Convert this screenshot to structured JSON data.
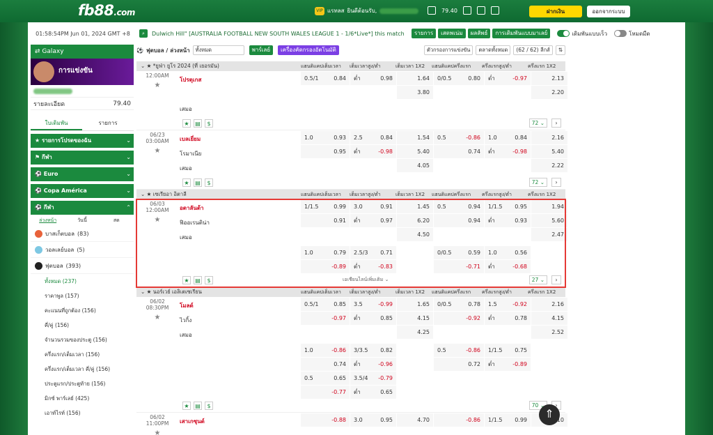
{
  "header": {
    "logo": "fb88",
    "logo_com": ".com",
    "user_label": "แรทลส",
    "greet": "ยินดีต้อนรับ,",
    "bal": "79.40",
    "vip": "VIP",
    "deposit": "ฝากเงิน",
    "logout": "ออกจากระบบ"
  },
  "strip": {
    "time": "01:58:54PM Jun 01, 2024 GMT +8",
    "marquee": "Dulwich Hill\" [AUSTRALIA FOOTBALL NEW SOUTH WALES LEAGUE 1 - 1/6*Live*] this match",
    "b1": "รายการ",
    "b2": "เสดพเน่ม",
    "b3": "ผลลัพธ์",
    "b4": "การเดิมพันแบบมาเลย์",
    "t1": "เดิมพันแบบเร็ว",
    "t2": "โหมดมืด"
  },
  "sidebar": {
    "galaxy": "Galaxy",
    "promo": "การแข่งขัน",
    "bal_label": "รายละเอียด",
    "bal_val": "79.40",
    "tab1": "ใบเดิมพัน",
    "tab2": "รายการ",
    "s1": "รายการโปรดของฉัน",
    "s2": "กีฬา",
    "s3": "Euro",
    "s4": "Copa América",
    "s5": "กีฬา",
    "sub1": "ล่วงหน้า",
    "sub2": "วันนี้",
    "sub3": "สด",
    "sports": [
      {
        "n": "บาสเก็ตบอล",
        "c": "(83)"
      },
      {
        "n": "วอลเลย์บอล",
        "c": "(5)"
      },
      {
        "n": "ฟุตบอล",
        "c": "(393)"
      }
    ],
    "markets": [
      {
        "n": "ทั้งหมด",
        "c": "(237)"
      },
      {
        "n": "ราคาพูล",
        "c": "(157)"
      },
      {
        "n": "คะแนนที่ถูกต้อง",
        "c": "(156)"
      },
      {
        "n": "คี่/คู่",
        "c": "(156)"
      },
      {
        "n": "จำนวนรวมของประตู",
        "c": "(156)"
      },
      {
        "n": "ครึ่งแรก/เต็มเวลา",
        "c": "(156)"
      },
      {
        "n": "ครึ่งแรก/เต็มเวลา คี่/คู่",
        "c": "(156)"
      },
      {
        "n": "ประตูแรก/ประตูท้าย",
        "c": "(156)"
      },
      {
        "n": "มิกซ์ พาร์เลย์",
        "c": "(425)"
      },
      {
        "n": "เอาท์ไรท์",
        "c": "(156)"
      }
    ]
  },
  "toolbar": {
    "title": "ฟุตบอล / ล่วงหน้า",
    "filter": "ทั้งหมด",
    "parlay": "พาร์เลย์",
    "auto": "เครื่องคัดกรองอัตโนมัติ",
    "sort1": "ตัวกรองการแข่งขัน",
    "sort2": "ตลาดทั้งหมด",
    "leagues": "(62 / 62) ลีกส์"
  },
  "cols": [
    "แฮนดิแคปเต็มเวลา",
    "เต็มเวลาสูง/ต่ำ",
    "เต็มเวลา 1X2",
    "แฮนดิแคปครึ่งแรก",
    "ครึ่งแรกสูง/ต่ำ",
    "ครึ่งแรก 1X2"
  ],
  "leagues": [
    {
      "name": "*ยูฟ่า ยูโร 2024 (ที่ เยอรมัน)",
      "matches": [
        {
          "date": "",
          "time": "12:00AM",
          "home": "โปรตุเกส",
          "away": "",
          "draw": "เสมอ",
          "count": "72",
          "rows": [
            [
              "0.5/1",
              "0.84",
              "ต่ำ",
              "0.98",
              "1.64",
              "0/0.5",
              "0.80",
              "ต่ำ",
              "-0.97",
              "2.13"
            ],
            [
              "",
              "",
              "",
              "",
              "3.80",
              "",
              "",
              "",
              "",
              "2.20"
            ]
          ]
        },
        {
          "date": "06/23",
          "time": "03:00AM",
          "home": "เบลเยี่ยม",
          "away": "โรมาเนีย",
          "draw": "เสมอ",
          "count": "72",
          "rows": [
            [
              "1.0",
              "0.93",
              "2.5",
              "0.84",
              "1.54",
              "0.5",
              "-0.86",
              "1.0",
              "0.84",
              "2.16"
            ],
            [
              "",
              "0.95",
              "ต่ำ",
              "-0.98",
              "5.40",
              "",
              "0.74",
              "ต่ำ",
              "-0.98",
              "5.40"
            ],
            [
              "",
              "",
              "",
              "",
              "4.05",
              "",
              "",
              "",
              "",
              "2.22"
            ]
          ]
        }
      ]
    },
    {
      "name": "เซเรียอา อิตาลี",
      "matches": [
        {
          "date": "06/03",
          "time": "12:00AM",
          "home": "อตาลันต้า",
          "away": "ฟิออเรนติน่า",
          "draw": "เสมอ",
          "count": "27",
          "more": "เอเชียนไลน์เพิ่มเติม",
          "rows": [
            [
              "1/1.5",
              "0.99",
              "3.0",
              "0.91",
              "1.45",
              "0.5",
              "0.94",
              "1/1.5",
              "0.95",
              "1.94"
            ],
            [
              "",
              "0.91",
              "ต่ำ",
              "0.97",
              "6.20",
              "",
              "0.94",
              "ต่ำ",
              "0.93",
              "5.60"
            ],
            [
              "",
              "",
              "",
              "",
              "4.50",
              "",
              "",
              "",
              "",
              "2.47"
            ],
            [
              "1.0",
              "0.79",
              "2.5/3",
              "0.71",
              "",
              "0/0.5",
              "0.59",
              "1.0",
              "0.56",
              ""
            ],
            [
              "",
              "-0.89",
              "ต่ำ",
              "-0.83",
              "",
              "",
              "-0.71",
              "ต่ำ",
              "-0.68",
              ""
            ]
          ]
        }
      ]
    },
    {
      "name": "นอร์เวย์ เอลิเตเซเรียน",
      "matches": [
        {
          "date": "06/02",
          "time": "08:30PM",
          "home": "โมลด์",
          "away": "ไวกิ้ง",
          "draw": "เสมอ",
          "count": "70",
          "rows": [
            [
              "0.5/1",
              "0.85",
              "3.5",
              "-0.99",
              "1.65",
              "0/0.5",
              "0.78",
              "1.5",
              "-0.92",
              "2.16"
            ],
            [
              "",
              "-0.97",
              "ต่ำ",
              "0.85",
              "4.15",
              "",
              "-0.92",
              "ต่ำ",
              "0.78",
              "4.15"
            ],
            [
              "",
              "",
              "",
              "",
              "4.25",
              "",
              "",
              "",
              "",
              "2.52"
            ],
            [
              "1.0",
              "-0.86",
              "3/3.5",
              "0.82",
              "",
              "0.5",
              "-0.86",
              "1/1.5",
              "0.75",
              ""
            ],
            [
              "",
              "0.74",
              "ต่ำ",
              "-0.96",
              "",
              "",
              "0.72",
              "ต่ำ",
              "-0.89",
              ""
            ],
            [
              "0.5",
              "0.65",
              "3.5/4",
              "-0.79",
              "",
              "",
              "",
              "",
              "",
              ""
            ],
            [
              "",
              "-0.77",
              "ต่ำ",
              "0.65",
              "",
              "",
              "",
              "",
              "",
              ""
            ]
          ]
        },
        {
          "date": "06/02",
          "time": "11:00PM",
          "home": "เสาเกซุนด์",
          "away": "",
          "draw": "",
          "count": "",
          "rows": [
            [
              "",
              "-0.88",
              "3.0",
              "0.95",
              "4.70",
              "",
              "-0.86",
              "1/1.5",
              "0.99",
              "5.10"
            ]
          ]
        }
      ]
    }
  ]
}
